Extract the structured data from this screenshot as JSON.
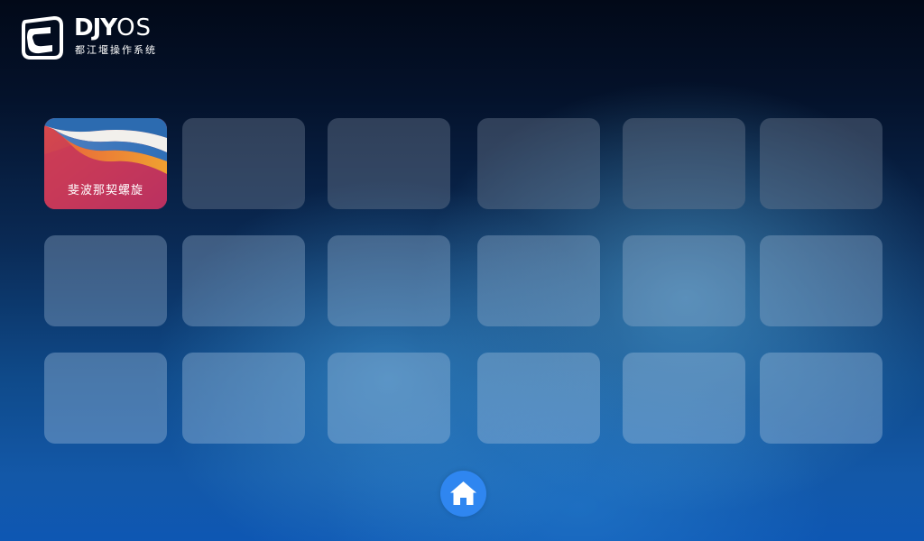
{
  "logo": {
    "wordmark_bold": "DJY",
    "wordmark_thin": "OS",
    "subtitle": "都江堰操作系统",
    "icon": "djy-logo-icon"
  },
  "tiles": [
    {
      "label": "斐波那契螺旋",
      "type": "app",
      "icon": "colorful-wave-wallpaper"
    },
    {
      "label": null,
      "type": "empty"
    },
    {
      "label": null,
      "type": "empty"
    },
    {
      "label": null,
      "type": "empty"
    },
    {
      "label": null,
      "type": "empty"
    },
    {
      "label": null,
      "type": "empty"
    },
    {
      "label": null,
      "type": "empty"
    },
    {
      "label": null,
      "type": "empty"
    },
    {
      "label": null,
      "type": "empty"
    },
    {
      "label": null,
      "type": "empty"
    },
    {
      "label": null,
      "type": "empty"
    },
    {
      "label": null,
      "type": "empty"
    },
    {
      "label": null,
      "type": "empty"
    },
    {
      "label": null,
      "type": "empty"
    },
    {
      "label": null,
      "type": "empty"
    },
    {
      "label": null,
      "type": "empty"
    },
    {
      "label": null,
      "type": "empty"
    },
    {
      "label": null,
      "type": "empty"
    }
  ],
  "dock": {
    "home_icon": "home-icon"
  },
  "colors": {
    "home_button": "#2f86f0",
    "background_top": "#020918",
    "background_bottom": "#0e57b3"
  }
}
